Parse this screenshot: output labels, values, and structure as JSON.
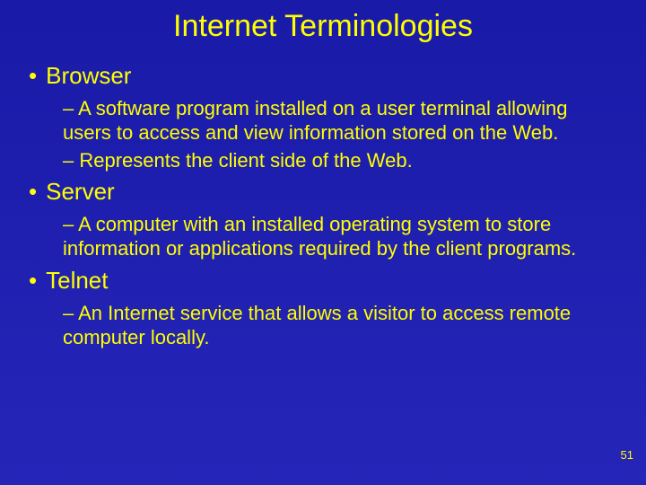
{
  "title": "Internet Terminologies",
  "sections": [
    {
      "term": "Browser",
      "items": [
        "– A software program installed on a user terminal allowing users to access and view information stored on the Web.",
        "– Represents the client side of the Web."
      ]
    },
    {
      "term": "Server",
      "items": [
        "– A computer with an installed operating system to store information or applications required by the client programs."
      ]
    },
    {
      "term": "Telnet",
      "items": [
        "– An Internet service that allows a visitor to access remote computer locally."
      ]
    }
  ],
  "pageNumber": "51",
  "bullet1": "•"
}
